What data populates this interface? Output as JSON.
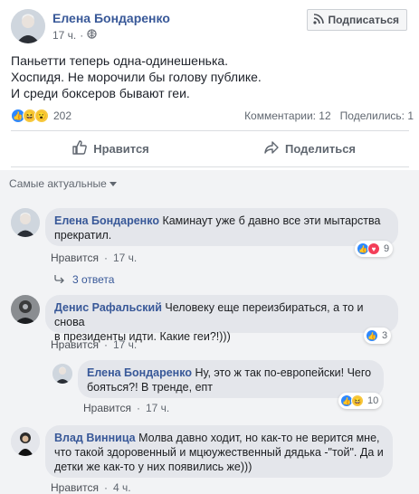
{
  "post": {
    "author": "Елена Бондаренко",
    "time": "17 ч.",
    "subscribe_label": "Подписаться",
    "lines": [
      "Паньетти теперь одна-одинешенька.",
      "Хоспидя. Не морочили бы голову публике.",
      "И среди боксеров бывают геи."
    ],
    "reactions_count": "202",
    "comments_label": "Комментарии: 12",
    "shares_label": "Поделились: 1",
    "like_label": "Нравится",
    "share_label": "Поделиться"
  },
  "comments_section": {
    "sort_label": "Самые актуальные",
    "comments": [
      {
        "author": "Елена Бондаренко",
        "text_line1": "Каминаут уже б давно все эти мытарства",
        "text_line2": "прекратил.",
        "like_action": "Нравится",
        "time": "17 ч.",
        "reactions": "9",
        "replies_label": "3 ответа"
      },
      {
        "author": "Денис Рафальский",
        "text_line1": "Человеку еще переизбираться, а то и снова",
        "text_line2": "в президенты идти. Какие геи?!)))",
        "like_action": "Нравится",
        "time": "17 ч.",
        "reactions": "3"
      },
      {
        "author": "Елена Бондаренко",
        "text_line1": "Ну, это ж так по-европейски! Чего",
        "text_line2": "бояться?! В тренде, епт",
        "like_action": "Нравится",
        "time": "17 ч.",
        "reactions": "10"
      },
      {
        "author": "Влад Винница",
        "text_line1": "Молва давно ходит, но как-то не верится мне,",
        "text_line2": "что такой здоровенный и мцюужественный дядька -\"той\". Да и",
        "text_line3": "детки же как-то у них появились же)))",
        "like_action": "Нравится",
        "time": "4 ч."
      }
    ]
  },
  "colors": {
    "link": "#385898",
    "bubble": "#e4e6eb",
    "like": "#2d88ff",
    "heart": "#f33e58",
    "haha": "#f7c93f"
  },
  "icons": [
    "globe-icon",
    "rss-icon",
    "thumbs-up-icon",
    "share-arrow-icon",
    "caret-down-icon",
    "reply-arrow-icon"
  ]
}
